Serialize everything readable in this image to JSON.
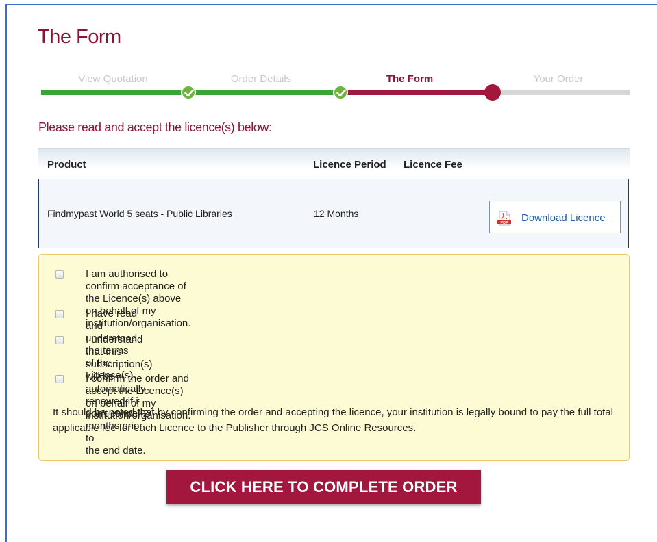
{
  "page": {
    "title": "The Form"
  },
  "stepper": {
    "steps": [
      {
        "label": "View Quotation",
        "state": "done"
      },
      {
        "label": "Order Details",
        "state": "done"
      },
      {
        "label": "The Form",
        "state": "current"
      },
      {
        "label": "Your Order",
        "state": "pending"
      }
    ]
  },
  "intro": "Please read and accept the licence(s) below:",
  "table": {
    "headers": {
      "product": "Product",
      "period": "Licence Period",
      "fee": "Licence Fee"
    },
    "rows": [
      {
        "product": "Findmypast World 5 seats - Public Libraries",
        "period": "12 Months",
        "fee": "",
        "download_label": "Download Licence"
      }
    ]
  },
  "acceptance": {
    "checks": [
      {
        "line1": "I am authorised to confirm acceptance of the Licence(s) above on behalf of my",
        "line2": "institution/organisation."
      },
      {
        "line1": "I have read and understood the terms of the Licence(s).",
        "line2": ""
      },
      {
        "line1": "I understand that this subscription(s) will be automatically renewed if i don't cancel 2 months prior to",
        "line2": "the end date."
      },
      {
        "line1": "I confirm the order and accept the Licence(s) on behalf of my institution/organisation.",
        "line2": ""
      }
    ],
    "note": "It should be noted that by confirming the order and accepting the licence, your institution is legally bound to pay the full total applicable fee for each Licence to the Publisher through JCS Online Resources."
  },
  "complete_button": "CLICK HERE TO COMPLETE ORDER",
  "colors": {
    "brand": "#8a1538",
    "accent": "#a3163e",
    "done": "#3aa33a",
    "link": "#1e5aa8"
  }
}
